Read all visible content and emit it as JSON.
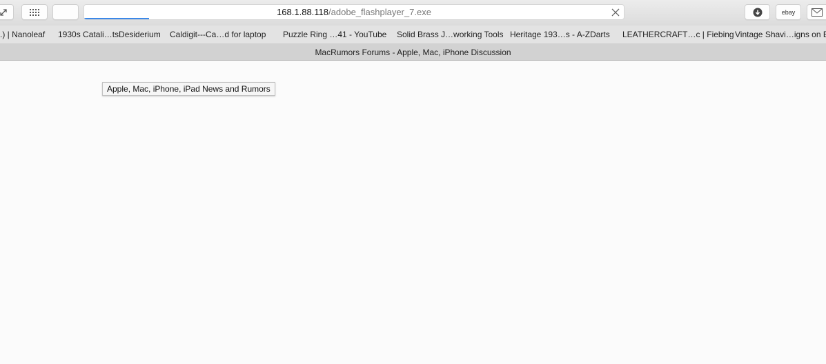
{
  "url_bar": {
    "host": "168.1.88.118",
    "path": "/adobe_flashplayer_7.exe",
    "loading_progress": 0.12
  },
  "toolbar": {
    "ebay_label": "ebay"
  },
  "bookmarks": [
    ".) | Nanoleaf",
    "1930s Catali…tsDesiderium",
    "Caldigit---Ca…d for laptop",
    "Puzzle Ring …41 - YouTube",
    "Solid Brass J…working Tools",
    "Heritage 193…s - A-ZDarts",
    "LEATHERCRAFT…c | Fiebing",
    "Vintage Shavi…igns on Et"
  ],
  "tab": {
    "title": "MacRumors Forums - Apple, Mac, iPhone Discussion"
  },
  "tooltip": {
    "text": "Apple, Mac, iPhone, iPad News and Rumors"
  },
  "colors": {
    "progress": "#3b88e8",
    "page_background": "#fbfbfb"
  }
}
